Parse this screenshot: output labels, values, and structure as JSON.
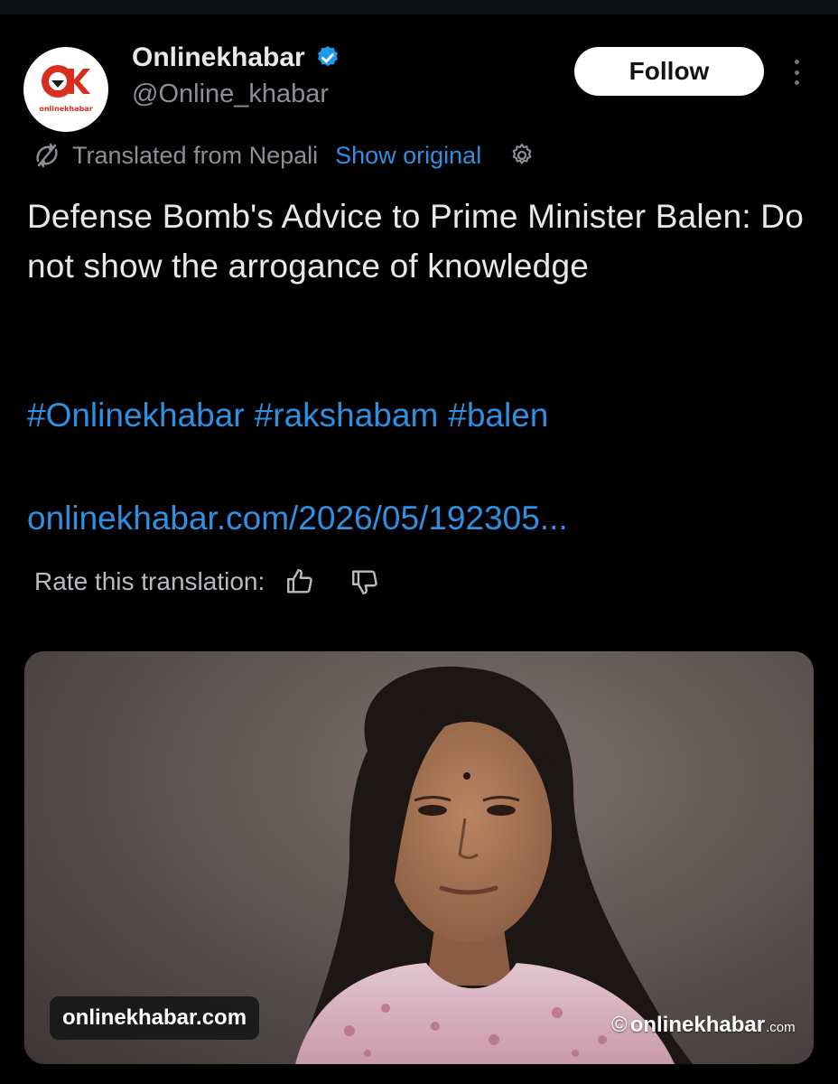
{
  "account": {
    "name": "Onlinekhabar",
    "handle": "@Online_khabar",
    "avatar_text": "onlinekhabar",
    "verified": true,
    "verified_color": "#1d9bf0"
  },
  "follow_button": {
    "label": "Follow"
  },
  "translation": {
    "label": "Translated from Nepali",
    "show_original": "Show original",
    "rate_label": "Rate this translation:"
  },
  "tweet": {
    "text": "Defense Bomb's Advice to Prime Minister Balen: Do not show the arrogance of knowledge",
    "hashtags": [
      "#Onlinekhabar",
      "#rakshabam",
      "#balen"
    ],
    "link": "onlinekhabar.com/2026/05/192305..."
  },
  "media": {
    "watermark_left": "onlinekhabar.com",
    "watermark_right_main": "onlinekhabar",
    "watermark_right_suffix": ".com",
    "watermark_symbol": "©"
  },
  "colors": {
    "background": "#000000",
    "link": "#2f8fe0",
    "secondary_text": "#8b9097",
    "brand_red": "#d92d20"
  },
  "icons": [
    "verified-badge-icon",
    "more-icon",
    "translate-icon",
    "settings-icon",
    "thumbs-up-icon",
    "thumbs-down-icon"
  ]
}
